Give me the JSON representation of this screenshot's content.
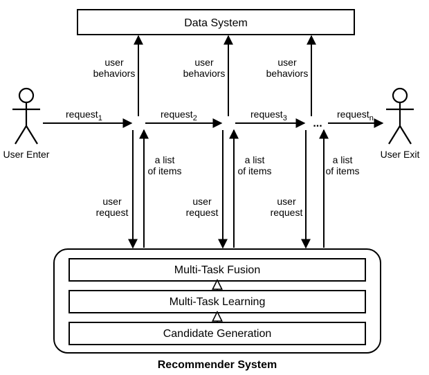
{
  "top_box": {
    "label": "Data System"
  },
  "bottom_system": {
    "caption": "Recommender System",
    "layer_top": "Multi-Task Fusion",
    "layer_mid": "Multi-Task Learning",
    "layer_bot": "Candidate Generation"
  },
  "actors": {
    "left_label": "User Enter",
    "right_label": "User Exit"
  },
  "requests": {
    "r1_pre": "request",
    "r1_sub": "1",
    "r2_pre": "request",
    "r2_sub": "2",
    "r3_pre": "request",
    "r3_sub": "3",
    "rn_pre": "request",
    "rn_sub": "n"
  },
  "ellipsis": "...",
  "up_label_l1": "user",
  "up_label_l2": "behaviors",
  "down_left_l1": "user",
  "down_left_l2": "request",
  "down_right_l1": "a list",
  "down_right_l2": "of items"
}
